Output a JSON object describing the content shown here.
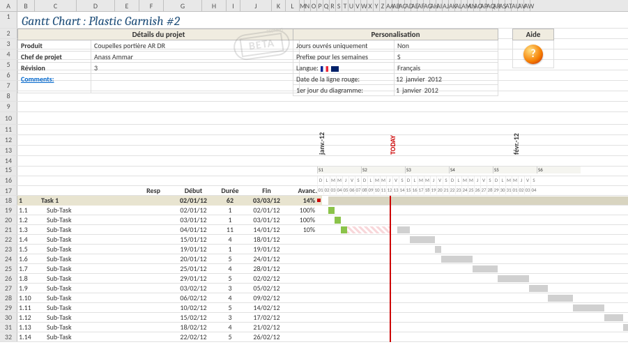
{
  "title": "Gantt Chart : Plastic Garnish #2",
  "details": {
    "header": "Détails du projet",
    "produit_label": "Produit",
    "produit_value": "Coupelles portière AR DR",
    "chef_label": "Chef de projet",
    "chef_value": "Anass Ammar",
    "rev_label": "Révision",
    "rev_value": "3",
    "comments_label": "Comments:"
  },
  "person": {
    "header": "Personalisation",
    "jours_label": "Jours ouvrés uniquement",
    "jours_value": "Non",
    "prefixe_label": "Prefixe pour les semaines",
    "prefixe_value": "S",
    "langue_label": "Langue:",
    "langue_value": "Français",
    "redline_label": "Date de la ligne rouge:",
    "redline_d": "12",
    "redline_m": "janvier",
    "redline_y": "2012",
    "firstday_label": "1er jour du diagramme:",
    "firstday_d": "1",
    "firstday_m": "janvier",
    "firstday_y": "2012"
  },
  "help": {
    "header": "Aide"
  },
  "beta": "BETA",
  "timeline": {
    "month1": "janv.-12",
    "month2": "févr.-12",
    "today": "TODAY",
    "weeks": [
      "S1",
      "S2",
      "S3",
      "S4",
      "S5",
      "S6"
    ],
    "day_letters": [
      "D",
      "L",
      "M",
      "M",
      "J",
      "V",
      "S"
    ],
    "day_nums_jan": [
      "01",
      "02",
      "03",
      "04",
      "05",
      "06",
      "07",
      "08",
      "09",
      "10",
      "11",
      "12",
      "13",
      "14",
      "15",
      "16",
      "17",
      "18",
      "19",
      "20",
      "21",
      "22",
      "23",
      "24",
      "25",
      "26",
      "27",
      "28",
      "29",
      "30",
      "31"
    ],
    "day_nums_feb": [
      "01",
      "02",
      "03",
      "04"
    ]
  },
  "task_headers": {
    "resp": "Resp",
    "debut": "Début",
    "duree": "Durée",
    "fin": "Fin",
    "avanc": "Avanc."
  },
  "tasks": [
    {
      "id": "1",
      "name": "Task 1",
      "debut": "02/01/12",
      "duree": "62",
      "fin": "03/03/12",
      "avanc": "14%",
      "main": true
    },
    {
      "id": "1.1",
      "name": "Sub-Task",
      "debut": "02/01/12",
      "duree": "1",
      "fin": "02/01/12",
      "avanc": "100%"
    },
    {
      "id": "1.2",
      "name": "Sub-Task",
      "debut": "03/01/12",
      "duree": "1",
      "fin": "03/01/12",
      "avanc": "100%"
    },
    {
      "id": "1.3",
      "name": "Sub-Task",
      "debut": "04/01/12",
      "duree": "11",
      "fin": "14/01/12",
      "avanc": "10%"
    },
    {
      "id": "1.4",
      "name": "Sub-Task",
      "debut": "15/01/12",
      "duree": "4",
      "fin": "18/01/12",
      "avanc": ""
    },
    {
      "id": "1.5",
      "name": "Sub-Task",
      "debut": "19/01/12",
      "duree": "1",
      "fin": "19/01/12",
      "avanc": ""
    },
    {
      "id": "1.6",
      "name": "Sub-Task",
      "debut": "20/01/12",
      "duree": "5",
      "fin": "24/01/12",
      "avanc": ""
    },
    {
      "id": "1.7",
      "name": "Sub-Task",
      "debut": "25/01/12",
      "duree": "4",
      "fin": "28/01/12",
      "avanc": ""
    },
    {
      "id": "1.8",
      "name": "Sub-Task",
      "debut": "29/01/12",
      "duree": "5",
      "fin": "02/02/12",
      "avanc": ""
    },
    {
      "id": "1.9",
      "name": "Sub-Task",
      "debut": "03/02/12",
      "duree": "3",
      "fin": "05/02/12",
      "avanc": ""
    },
    {
      "id": "1.10",
      "name": "Sub-Task",
      "debut": "06/02/12",
      "duree": "4",
      "fin": "09/02/12",
      "avanc": ""
    },
    {
      "id": "1.11",
      "name": "Sub-Task",
      "debut": "10/02/12",
      "duree": "5",
      "fin": "14/02/12",
      "avanc": ""
    },
    {
      "id": "1.12",
      "name": "Sub-Task",
      "debut": "15/02/12",
      "duree": "3",
      "fin": "17/02/12",
      "avanc": ""
    },
    {
      "id": "1.13",
      "name": "Sub-Task",
      "debut": "18/02/12",
      "duree": "4",
      "fin": "21/02/12",
      "avanc": ""
    },
    {
      "id": "1.14",
      "name": "Sub-Task",
      "debut": "22/02/12",
      "duree": "5",
      "fin": "26/02/12",
      "avanc": ""
    }
  ],
  "col_letters": [
    "A",
    "B",
    "C",
    "D",
    "E",
    "F",
    "G",
    "H",
    "I",
    "J",
    "K",
    "L",
    "M",
    "N",
    "O",
    "P",
    "Q",
    "R",
    "S",
    "T",
    "U",
    "V",
    "W",
    "X",
    "Y",
    "Z",
    "AA",
    "AB",
    "AC",
    "AD",
    "AE",
    "AF",
    "AG",
    "AH",
    "AI",
    "AJ",
    "AK",
    "AL",
    "AM",
    "AN",
    "AO",
    "AP",
    "AQ",
    "AR",
    "AS",
    "AT",
    "AU",
    "AV",
    "AW"
  ],
  "row_nums": [
    "1",
    "2",
    "3",
    "4",
    "5",
    "6",
    "7",
    "8",
    "9",
    "10",
    "11",
    "12",
    "13",
    "14",
    "15",
    "16",
    "17",
    "18",
    "19",
    "20",
    "21",
    "22",
    "23",
    "24",
    "25",
    "26",
    "27",
    "28",
    "29",
    "30",
    "31",
    "32"
  ],
  "chart_data": {
    "type": "gantt",
    "title": "Plastic Garnish #2",
    "date_range_start": "2012-01-01",
    "today_marker": "2012-01-12",
    "tasks": [
      {
        "id": "1",
        "name": "Task 1",
        "start": "2012-01-02",
        "duration_days": 62,
        "end": "2012-03-03",
        "progress": 0.14
      },
      {
        "id": "1.1",
        "name": "Sub-Task",
        "start": "2012-01-02",
        "duration_days": 1,
        "end": "2012-01-02",
        "progress": 1.0
      },
      {
        "id": "1.2",
        "name": "Sub-Task",
        "start": "2012-01-03",
        "duration_days": 1,
        "end": "2012-01-03",
        "progress": 1.0
      },
      {
        "id": "1.3",
        "name": "Sub-Task",
        "start": "2012-01-04",
        "duration_days": 11,
        "end": "2012-01-14",
        "progress": 0.1
      },
      {
        "id": "1.4",
        "name": "Sub-Task",
        "start": "2012-01-15",
        "duration_days": 4,
        "end": "2012-01-18",
        "progress": 0
      },
      {
        "id": "1.5",
        "name": "Sub-Task",
        "start": "2012-01-19",
        "duration_days": 1,
        "end": "2012-01-19",
        "progress": 0
      },
      {
        "id": "1.6",
        "name": "Sub-Task",
        "start": "2012-01-20",
        "duration_days": 5,
        "end": "2012-01-24",
        "progress": 0
      },
      {
        "id": "1.7",
        "name": "Sub-Task",
        "start": "2012-01-25",
        "duration_days": 4,
        "end": "2012-01-28",
        "progress": 0
      },
      {
        "id": "1.8",
        "name": "Sub-Task",
        "start": "2012-01-29",
        "duration_days": 5,
        "end": "2012-02-02",
        "progress": 0
      },
      {
        "id": "1.9",
        "name": "Sub-Task",
        "start": "2012-02-03",
        "duration_days": 3,
        "end": "2012-02-05",
        "progress": 0
      },
      {
        "id": "1.10",
        "name": "Sub-Task",
        "start": "2012-02-06",
        "duration_days": 4,
        "end": "2012-02-09",
        "progress": 0
      },
      {
        "id": "1.11",
        "name": "Sub-Task",
        "start": "2012-02-10",
        "duration_days": 5,
        "end": "2012-02-14",
        "progress": 0
      },
      {
        "id": "1.12",
        "name": "Sub-Task",
        "start": "2012-02-15",
        "duration_days": 3,
        "end": "2012-02-17",
        "progress": 0
      },
      {
        "id": "1.13",
        "name": "Sub-Task",
        "start": "2012-02-18",
        "duration_days": 4,
        "end": "2012-02-21",
        "progress": 0
      },
      {
        "id": "1.14",
        "name": "Sub-Task",
        "start": "2012-02-22",
        "duration_days": 5,
        "end": "2012-02-26",
        "progress": 0
      }
    ]
  }
}
